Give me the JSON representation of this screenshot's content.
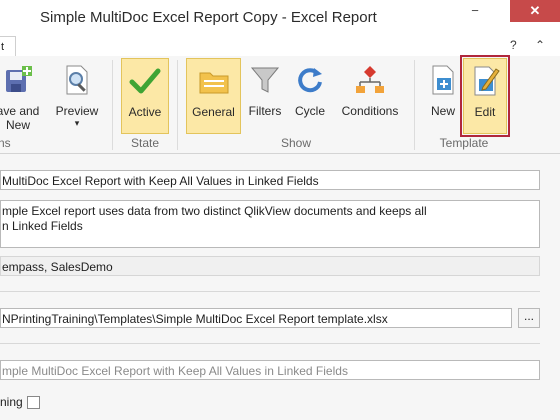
{
  "window": {
    "title": "Simple MultiDoc Excel Report Copy - Excel Report",
    "minimize": "−",
    "close": "✕"
  },
  "tabs": {
    "file_tab": "t"
  },
  "ribbon_controls": {
    "help": "?",
    "collapse": "⌃"
  },
  "ribbon": {
    "buttons": {
      "save_and_new": "ave and\nNew",
      "preview": "Preview",
      "preview_arrow": "▾",
      "active": "Active",
      "general": "General",
      "filters": "Filters",
      "cycle": "Cycle",
      "conditions": "Conditions",
      "new": "New",
      "edit": "Edit"
    },
    "groups": {
      "actions": "ns",
      "state": "State",
      "show": "Show",
      "template": "Template"
    }
  },
  "form": {
    "name": "MultiDoc Excel Report with Keep All Values in Linked Fields",
    "description_line1": "mple Excel report uses data from two distinct QlikView documents and keeps all",
    "description_line2": "n Linked Fields",
    "documents": "empass, SalesDemo",
    "template_path": "NPrintingTraining\\Templates\\Simple MultiDoc Excel Report template.xlsx",
    "browse": "...",
    "output_name": "mple MultiDoc Excel Report with Keep All Values in Linked Fields",
    "checkbox_label": "ning"
  },
  "colors": {
    "selected_bg": "#fce8a6",
    "highlight_outline": "#b1273c",
    "close_bg": "#c74a4a"
  }
}
